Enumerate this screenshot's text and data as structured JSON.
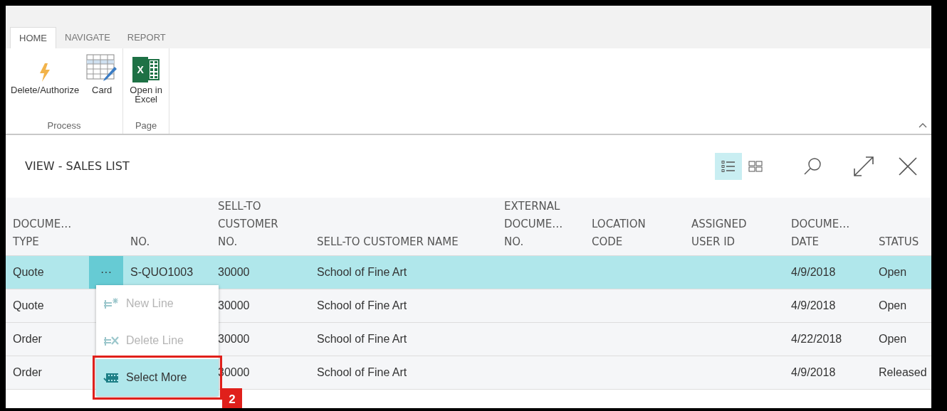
{
  "ribbon": {
    "tabs": [
      {
        "label": "HOME",
        "selected": true
      },
      {
        "label": "NAVIGATE",
        "selected": false
      },
      {
        "label": "REPORT",
        "selected": false
      }
    ],
    "groups": [
      {
        "label": "Process",
        "actions": [
          {
            "kind": "lightning",
            "label": "Delete/Authorize"
          },
          {
            "kind": "card",
            "label": "Card"
          }
        ]
      },
      {
        "label": "Page",
        "actions": [
          {
            "kind": "excel",
            "label": "Open in Excel",
            "badge": "X"
          }
        ]
      }
    ]
  },
  "page": {
    "title": "VIEW - SALES LIST",
    "view_modes": [
      {
        "kind": "list",
        "selected": true
      },
      {
        "kind": "tiles",
        "selected": false
      }
    ]
  },
  "table": {
    "columns": [
      "DOCUME…\nTYPE",
      "NO.",
      "SELL-TO\nCUSTOMER\nNO.",
      "SELL-TO CUSTOMER NAME",
      "EXTERNAL\nDOCUME…\nNO.",
      "LOCATION\nCODE",
      "ASSIGNED\nUSER ID",
      "DOCUME…\nDATE",
      "STATUS"
    ],
    "row_action": "···",
    "rows": [
      {
        "document_type": "Quote",
        "no": "S-QUO1003",
        "customer_no": "30000",
        "customer_name": "School of Fine Art",
        "document_date": "4/9/2018",
        "status": "Open",
        "selected": true
      },
      {
        "document_type": "Quote",
        "customer_no": "30000",
        "customer_name": "School of Fine Art",
        "document_date": "4/9/2018",
        "status": "Open",
        "selected": false
      },
      {
        "document_type": "Order",
        "customer_no": "30000",
        "customer_name": "School of Fine Art",
        "document_date": "4/22/2018",
        "status": "Open",
        "selected": false
      },
      {
        "document_type": "Order",
        "customer_no": "30000",
        "customer_name": "School of Fine Art",
        "document_date": "4/9/2018",
        "status": "Released",
        "selected": false
      }
    ]
  },
  "context_menu": {
    "items": [
      {
        "kind": "new",
        "label": "New Line",
        "disabled": true,
        "selected": false,
        "highlighted": false
      },
      {
        "kind": "delete",
        "label": "Delete Line",
        "disabled": true,
        "selected": false,
        "highlighted": false
      },
      {
        "kind": "select",
        "label": "Select More",
        "disabled": false,
        "selected": true,
        "highlighted": true
      }
    ]
  },
  "callout": {
    "number": "2"
  }
}
